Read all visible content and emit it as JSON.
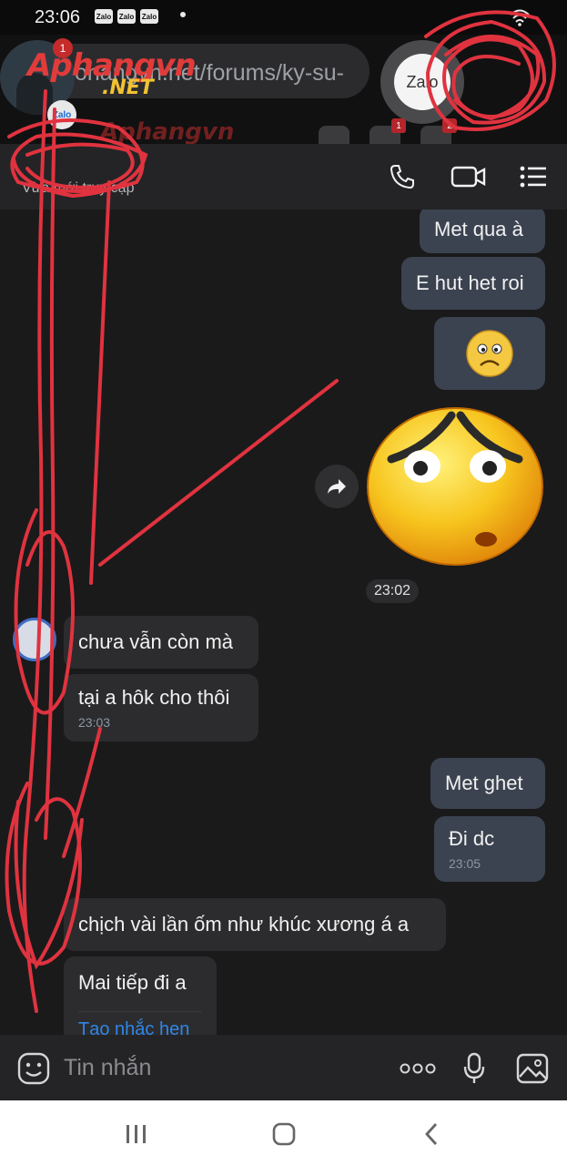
{
  "status_bar": {
    "time": "23:06",
    "notification_badges": [
      "Zalo",
      "Zalo",
      "Zalo"
    ]
  },
  "browser_overlay": {
    "url_text": "ohangvn.net/forums/ky-su-",
    "logo_text": "Aphangvn",
    "logo_suffix": ".NET",
    "logo_repeat": "Aphangvn",
    "zalo_bubble_label": "Zalo",
    "zalo_small_label": "Zalo",
    "avatar_notification": "1",
    "toolbar_badges": [
      "1",
      "2"
    ]
  },
  "chat_header": {
    "subtitle": "Vừa mới truy cập"
  },
  "messages": {
    "out1": "Met qua à",
    "out2": "E hut het roi",
    "emoji_small": "☹",
    "time_divider": "23:02",
    "in1": "chưa vẫn còn mà",
    "in2": "tại a hôk cho thôi",
    "in2_time": "23:03",
    "out3": "Met ghet",
    "out4": "Đi dc",
    "out4_time": "23:05",
    "in3": "chịch vài lần ốm như khúc xương á a",
    "in4": "Mai tiếp đi a",
    "in4_action": "Tạo nhắc hẹn"
  },
  "input_bar": {
    "placeholder": "Tin nhắn"
  },
  "colors": {
    "bubble_out": "#3b4350",
    "bubble_in": "#2c2c2e",
    "scribble_red": "#e0333f",
    "link_blue": "#2f86e8"
  },
  "icons": [
    "emoji-icon",
    "more-icon",
    "mic-icon",
    "image-icon",
    "phone-icon",
    "video-icon",
    "menu-icon",
    "forward-icon",
    "recent-apps-icon",
    "home-icon",
    "back-icon"
  ]
}
